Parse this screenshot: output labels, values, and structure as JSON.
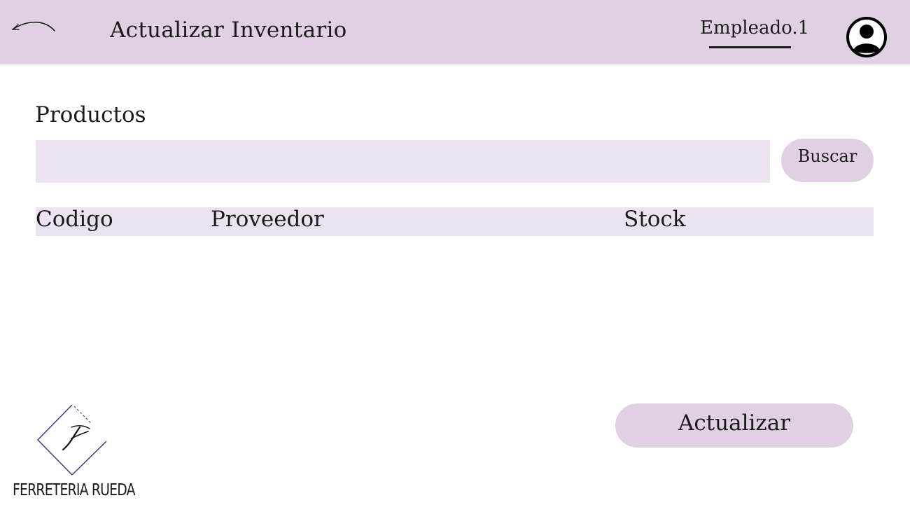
{
  "header": {
    "title": "Actualizar Inventario",
    "user_name": "Empleado.1",
    "back_icon": "back-arrow-icon",
    "avatar_icon": "user-avatar-icon"
  },
  "products": {
    "section_title": "Productos",
    "search_value": "",
    "search_placeholder": "",
    "search_button": "Buscar",
    "columns": [
      "Codigo",
      "Proveedor",
      "Stock"
    ],
    "rows": []
  },
  "actions": {
    "update_button": "Actualizar"
  },
  "brand": {
    "name": "FERRETERIA RUEDA",
    "logo_icon": "diamond-logo-icon"
  },
  "colors": {
    "header_bg": "#e0d1e2",
    "field_bg": "#ede3f0",
    "logo_accent": "#3d2f8a"
  }
}
